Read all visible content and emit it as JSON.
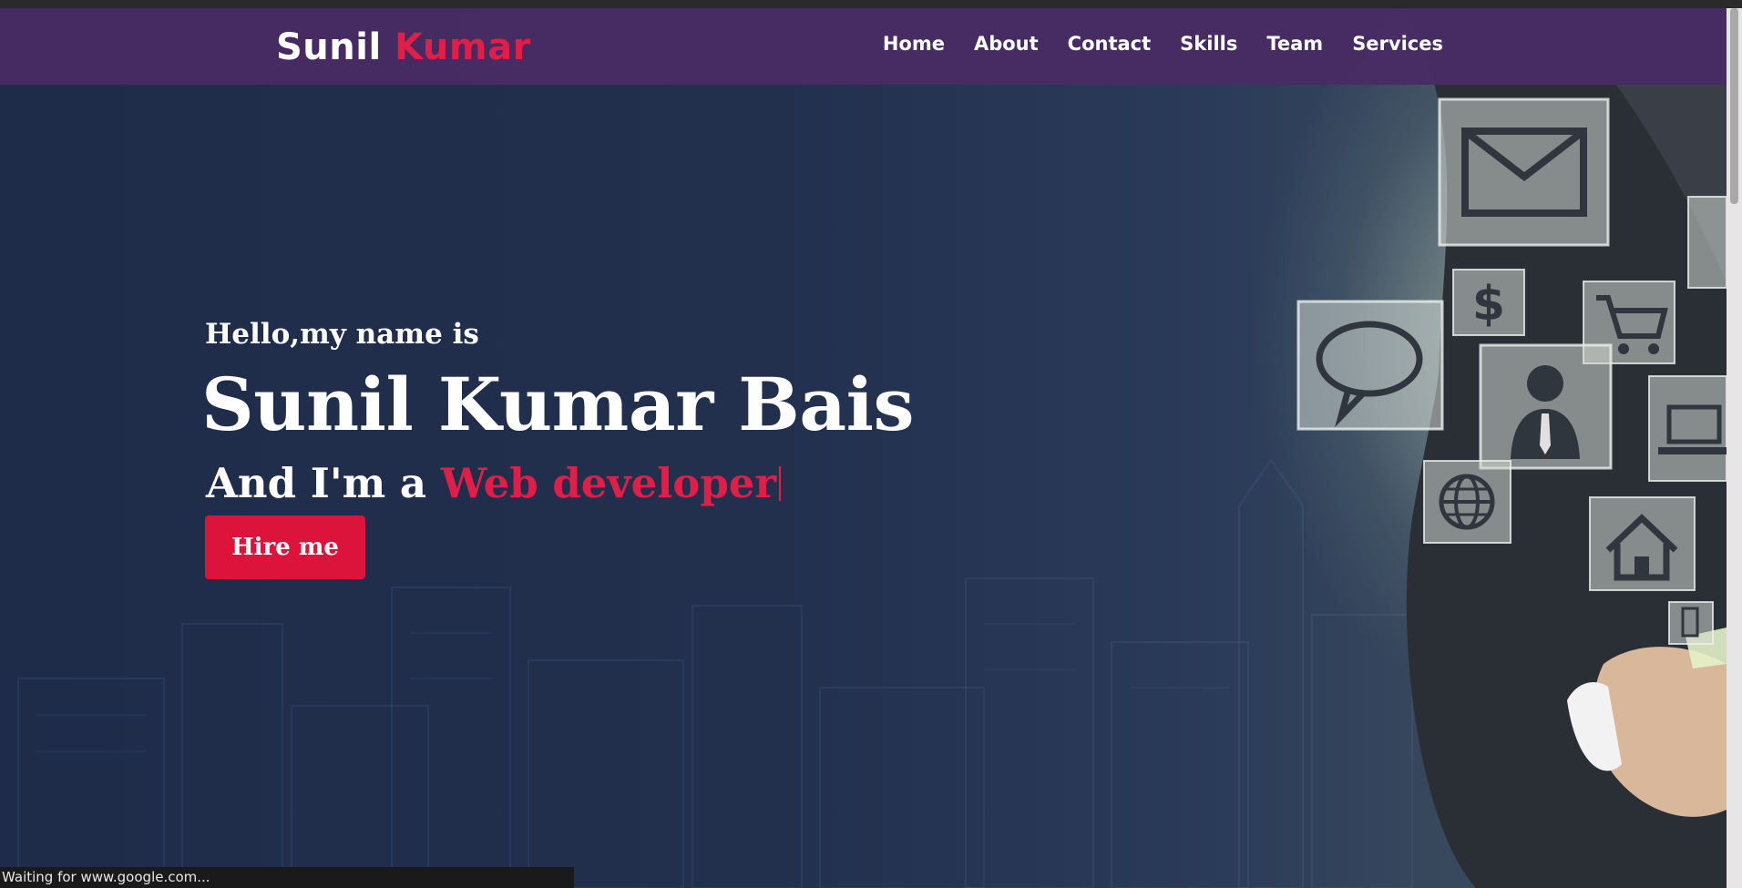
{
  "brand": {
    "first": "Sunil",
    "second": "Kumar"
  },
  "nav": {
    "items": [
      "Home",
      "About",
      "Contact",
      "Skills",
      "Team",
      "Services"
    ]
  },
  "hero": {
    "greeting": "Hello,my name is",
    "name": "Sunil Kumar Bais",
    "role_prefix": "And I'm a",
    "role_typed": "Web developer",
    "hire_label": "Hire me"
  },
  "status": {
    "text": "Waiting for www.google.com..."
  },
  "colors": {
    "accent": "#e01e47",
    "navbar": "#482c64",
    "background": "#1f2d4b",
    "button": "#dc143c"
  },
  "icons": [
    "mail-icon",
    "dollar-icon",
    "chat-icon",
    "cart-icon",
    "person-icon",
    "laptop-icon",
    "globe-icon",
    "home-icon"
  ]
}
